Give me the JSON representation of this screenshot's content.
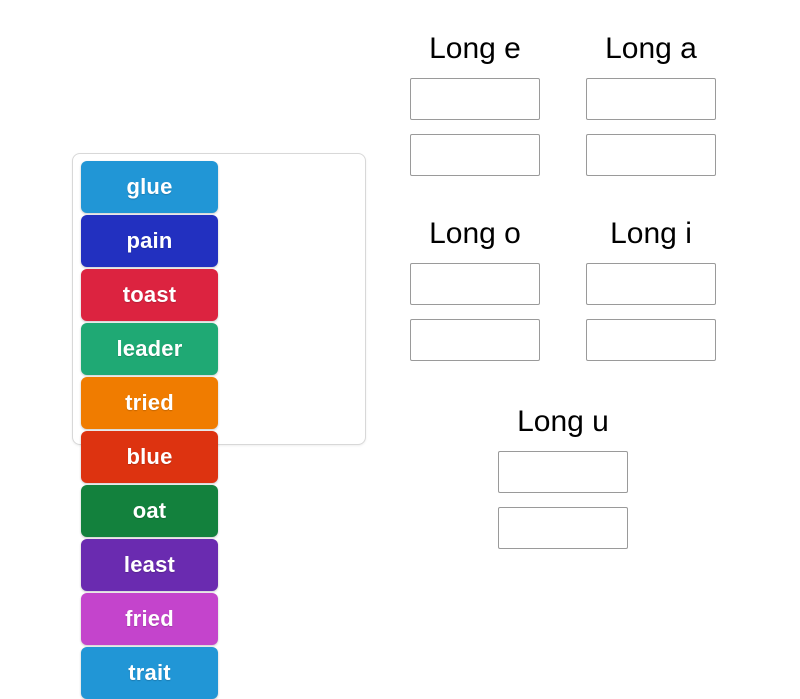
{
  "activity": {
    "background_color": "#ffffff"
  },
  "word_tray": {
    "name": "word-bank",
    "border_color": "#d8d8d8",
    "tiles": [
      {
        "label": "glue",
        "color": "#2196d6"
      },
      {
        "label": "pain",
        "color": "#2230c0"
      },
      {
        "label": "toast",
        "color": "#dc2340"
      },
      {
        "label": "leader",
        "color": "#1fa974"
      },
      {
        "label": "tried",
        "color": "#f07c00"
      },
      {
        "label": "blue",
        "color": "#dd3310"
      },
      {
        "label": "oat",
        "color": "#13813d"
      },
      {
        "label": "least",
        "color": "#6a2bb0"
      },
      {
        "label": "fried",
        "color": "#c444cc"
      },
      {
        "label": "trait",
        "color": "#2196d6"
      }
    ]
  },
  "categories": [
    {
      "title": "Long e",
      "slots": [
        "",
        ""
      ]
    },
    {
      "title": "Long a",
      "slots": [
        "",
        ""
      ]
    },
    {
      "title": "Long o",
      "slots": [
        "",
        ""
      ]
    },
    {
      "title": "Long i",
      "slots": [
        "",
        ""
      ]
    },
    {
      "title": "Long u",
      "slots": [
        "",
        ""
      ]
    }
  ]
}
